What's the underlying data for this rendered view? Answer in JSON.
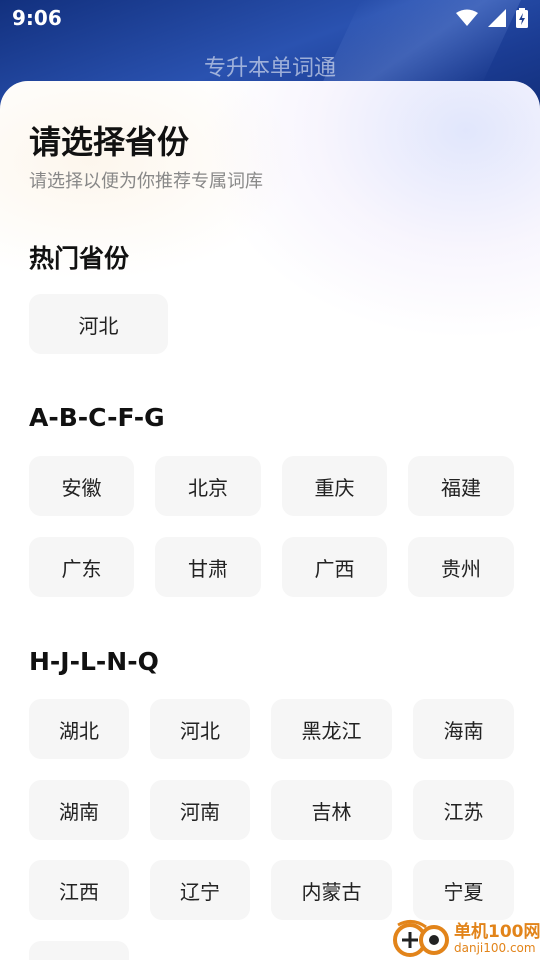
{
  "status_bar": {
    "time": "9:06"
  },
  "app": {
    "title": "专升本单词通"
  },
  "header": {
    "title": "请选择省份",
    "subtitle": "请选择以便为你推荐专属词库"
  },
  "sections": [
    {
      "title": "热门省份",
      "items": [
        "河北"
      ]
    },
    {
      "title": "A-B-C-F-G",
      "items": [
        "安徽",
        "北京",
        "重庆",
        "福建",
        "广东",
        "甘肃",
        "广西",
        "贵州"
      ]
    },
    {
      "title": "H-J-L-N-Q",
      "items": [
        "湖北",
        "河北",
        "黑龙江",
        "海南",
        "湖南",
        "河南",
        "吉林",
        "江苏",
        "江西",
        "辽宁",
        "内蒙古",
        "宁夏"
      ]
    }
  ],
  "watermark": {
    "cn": "单机100网",
    "en": "danji100.com"
  },
  "colors": {
    "header_blue": "#1f3f8f",
    "chip_bg": "#f6f6f6",
    "watermark_orange": "#e2841a"
  }
}
